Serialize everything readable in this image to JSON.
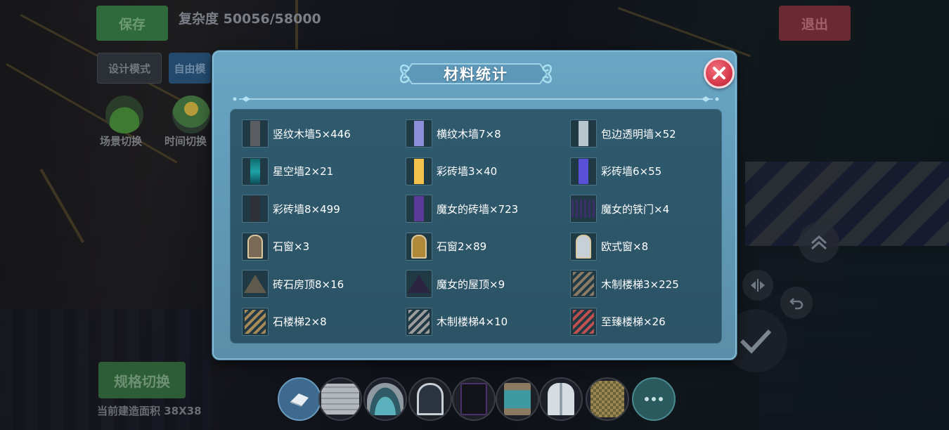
{
  "hud": {
    "save_label": "保存",
    "complexity_text": "复杂度 50056/58000",
    "exit_label": "退出",
    "design_mode_label": "设计模式",
    "free_label": "自由模",
    "scene_switch_label": "场景切换",
    "time_switch_label": "时间切换",
    "spec_switch_label": "规格切换",
    "area_text": "当前建造面积 38X38"
  },
  "modal": {
    "title": "材料统计",
    "close_icon": "close-x-icon",
    "items": [
      {
        "text": "竖纹木墙5×446",
        "icon": "vertical-wood-wall-icon",
        "color": "#5a5e62"
      },
      {
        "text": "横纹木墙7×8",
        "icon": "horizontal-wood-wall-icon",
        "color": "#8c8fd8"
      },
      {
        "text": "包边透明墙×52",
        "icon": "trimmed-glass-wall-icon",
        "color": "#b7c6cc"
      },
      {
        "text": "星空墙2×21",
        "icon": "starry-wall-icon",
        "color": "#1fa4a8"
      },
      {
        "text": "彩砖墙3×40",
        "icon": "yellow-brick-wall-icon",
        "color": "#f2c24a"
      },
      {
        "text": "彩砖墙6×55",
        "icon": "blue-brick-wall-icon",
        "color": "#5a50d8"
      },
      {
        "text": "彩砖墙8×499",
        "icon": "dark-brick-wall-icon",
        "color": "#2e3238"
      },
      {
        "text": "魔女的砖墙×723",
        "icon": "witch-brick-wall-icon",
        "color": "#5a3b9a"
      },
      {
        "text": "魔女的铁门×4",
        "icon": "witch-iron-gate-icon",
        "color": "#3b2f6a"
      },
      {
        "text": "石窗×3",
        "icon": "stone-window-icon",
        "color": "#7a6a55"
      },
      {
        "text": "石窗2×89",
        "icon": "arched-stone-window-icon",
        "color": "#b08a3a"
      },
      {
        "text": "欧式窗×8",
        "icon": "european-window-icon",
        "color": "#c7d0d6"
      },
      {
        "text": "砖石房顶8×16",
        "icon": "brick-roof-icon",
        "color": "#5e5a4c"
      },
      {
        "text": "魔女的屋顶×9",
        "icon": "witch-roof-icon",
        "color": "#2a2440"
      },
      {
        "text": "木制楼梯3×225",
        "icon": "wooden-stairs-icon",
        "color": "#8a7a66"
      },
      {
        "text": "石楼梯2×8",
        "icon": "stone-stairs-icon",
        "color": "#a88a5a"
      },
      {
        "text": "木制楼梯4×10",
        "icon": "wooden-stairs-2-icon",
        "color": "#9c9c9c"
      },
      {
        "text": "至臻楼梯×26",
        "icon": "premium-stairs-icon",
        "color": "#c05050"
      }
    ]
  },
  "toolbar": {
    "slots": [
      {
        "name": "eraser-tool-icon",
        "color": "#4e7aa0"
      },
      {
        "name": "stone-wall-block-icon",
        "color": "#9aa0a4"
      },
      {
        "name": "teal-arch-block-icon",
        "color": "#4a8a92"
      },
      {
        "name": "gothic-window-block-icon",
        "color": "#3e4a58"
      },
      {
        "name": "dark-panel-block-icon",
        "color": "#1c1e24"
      },
      {
        "name": "stone-window-block-icon",
        "color": "#7a6a55"
      },
      {
        "name": "european-window-block-icon",
        "color": "#c7d0d6"
      },
      {
        "name": "mosaic-block-icon",
        "color": "#8a7a4a"
      }
    ],
    "more_icon": "more-dots-icon"
  },
  "colors": {
    "modal_bg": "#6aa5c5",
    "panel_bg": "#2f5a6e",
    "close_red": "#d63a4b",
    "save_green": "#2f6b3a",
    "exit_red": "#6a2a33"
  }
}
